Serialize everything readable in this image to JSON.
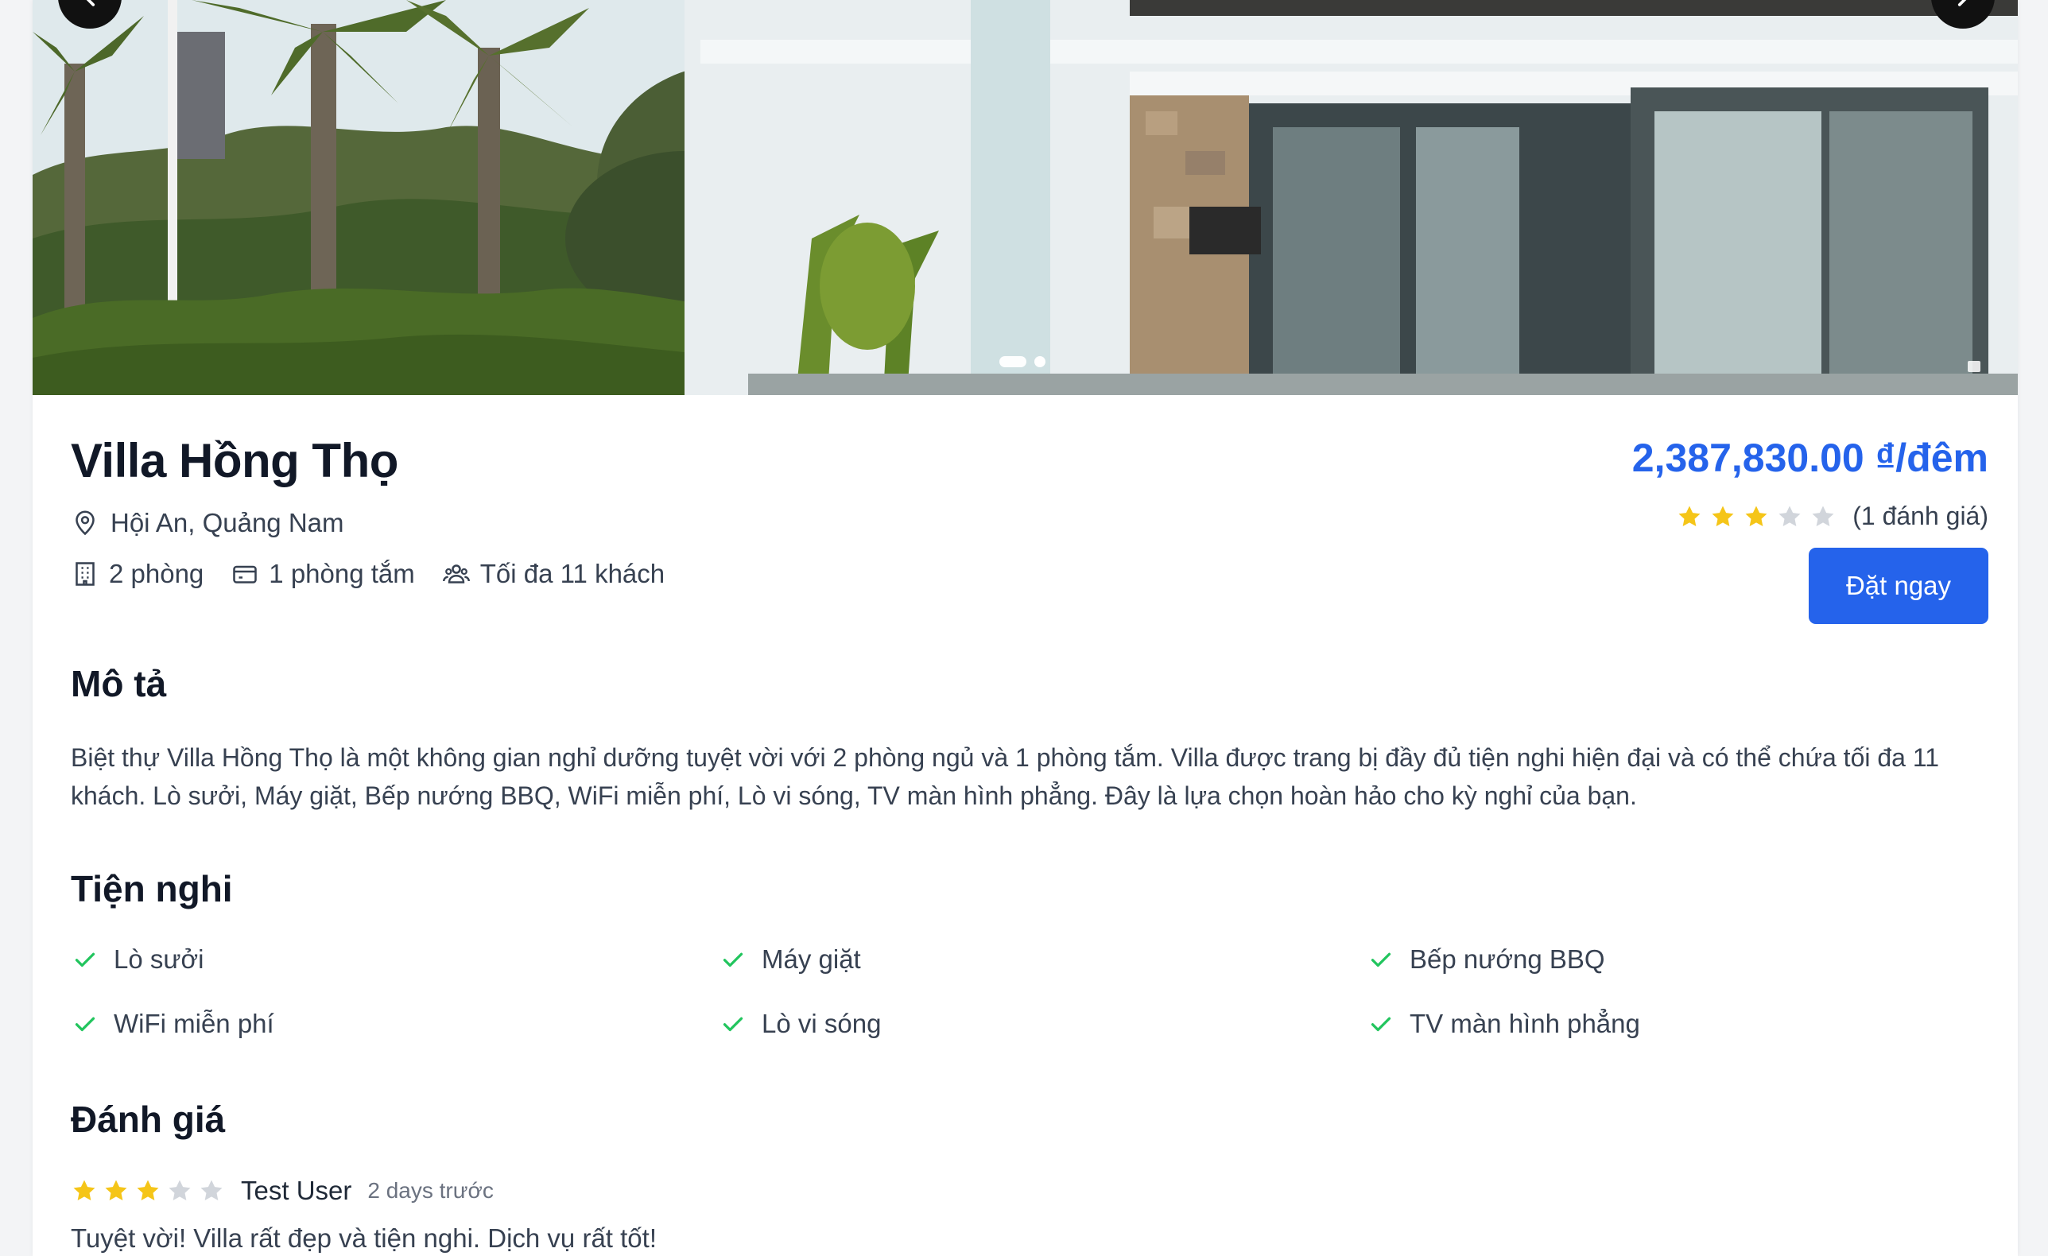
{
  "colors": {
    "accent": "#2563eb",
    "star_filled": "#f5c518",
    "star_empty": "#d1d5db",
    "check": "#22c55e"
  },
  "carousel": {
    "prev_icon": "chevron-left-icon",
    "next_icon": "chevron-right-icon",
    "slide_count": 2,
    "active_slide": 1
  },
  "villa": {
    "title": "Villa Hồng Thọ",
    "location": "Hội An, Quảng Nam",
    "rooms": "2 phòng",
    "bathrooms": "1 phòng tắm",
    "guests": "Tối đa 11 khách",
    "price": "2,387,830.00 ₫/đêm",
    "rating": 3,
    "rating_max": 5,
    "rating_count": "(1 đánh giá)",
    "book_label": "Đặt ngay"
  },
  "description": {
    "heading": "Mô tả",
    "text": "Biệt thự Villa Hồng Thọ là một không gian nghỉ dưỡng tuyệt vời với 2 phòng ngủ và 1 phòng tắm. Villa được trang bị đầy đủ tiện nghi hiện đại và có thể chứa tối đa 11 khách. Lò sưởi, Máy giặt, Bếp nướng BBQ, WiFi miễn phí, Lò vi sóng, TV màn hình phẳng. Đây là lựa chọn hoàn hảo cho kỳ nghỉ của bạn."
  },
  "amenities": {
    "heading": "Tiện nghi",
    "items": [
      "Lò sưởi",
      "Máy giặt",
      "Bếp nướng BBQ",
      "WiFi miễn phí",
      "Lò vi sóng",
      "TV màn hình phẳng"
    ]
  },
  "reviews": {
    "heading": "Đánh giá",
    "items": [
      {
        "user": "Test User",
        "date": "2 days trước",
        "rating": 3,
        "text": "Tuyệt vời! Villa rất đẹp và tiện nghi. Dịch vụ rất tốt!"
      }
    ]
  }
}
